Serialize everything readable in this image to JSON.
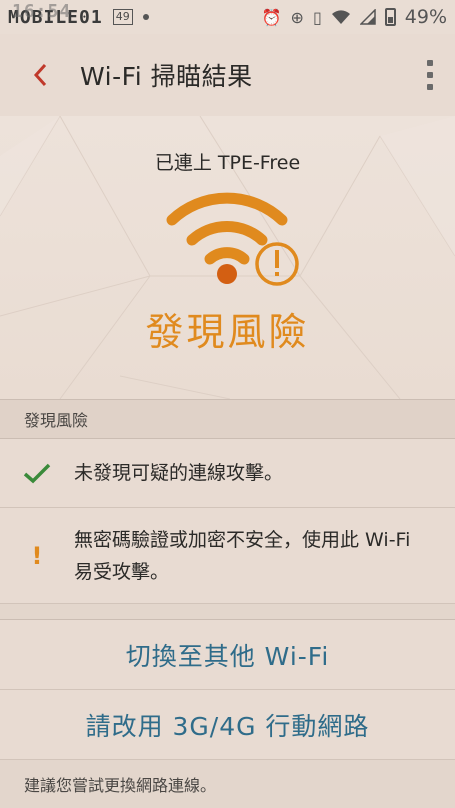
{
  "status_bar": {
    "watermark": "MOBILE01",
    "time": "16:54",
    "badge": "49",
    "battery_text": "49%",
    "icons": [
      "alarm-icon",
      "data-saver-icon",
      "vibrate-icon",
      "wifi-icon",
      "signal-icon",
      "battery-icon"
    ]
  },
  "header": {
    "title": "Wi-Fi 掃瞄結果"
  },
  "hero": {
    "connected_text": "已連上 TPE-Free",
    "risk_title": "發現風險"
  },
  "section": {
    "header": "發現風險"
  },
  "results": [
    {
      "icon": "check-icon",
      "text": "未發現可疑的連線攻擊。"
    },
    {
      "icon": "warning-icon",
      "text": "無密碼驗證或加密不安全，使用此 Wi-Fi 易受攻擊。"
    }
  ],
  "actions": {
    "switch_wifi": "切換至其他 Wi-Fi",
    "use_mobile": "請改用 3G/4G 行動網路"
  },
  "footer": {
    "note": "建議您嘗試更換網路連線。"
  },
  "colors": {
    "accent_orange": "#e08a1e",
    "back_red": "#c0392b",
    "link_blue": "#2f6c8a",
    "check_green": "#3a8a3a"
  }
}
